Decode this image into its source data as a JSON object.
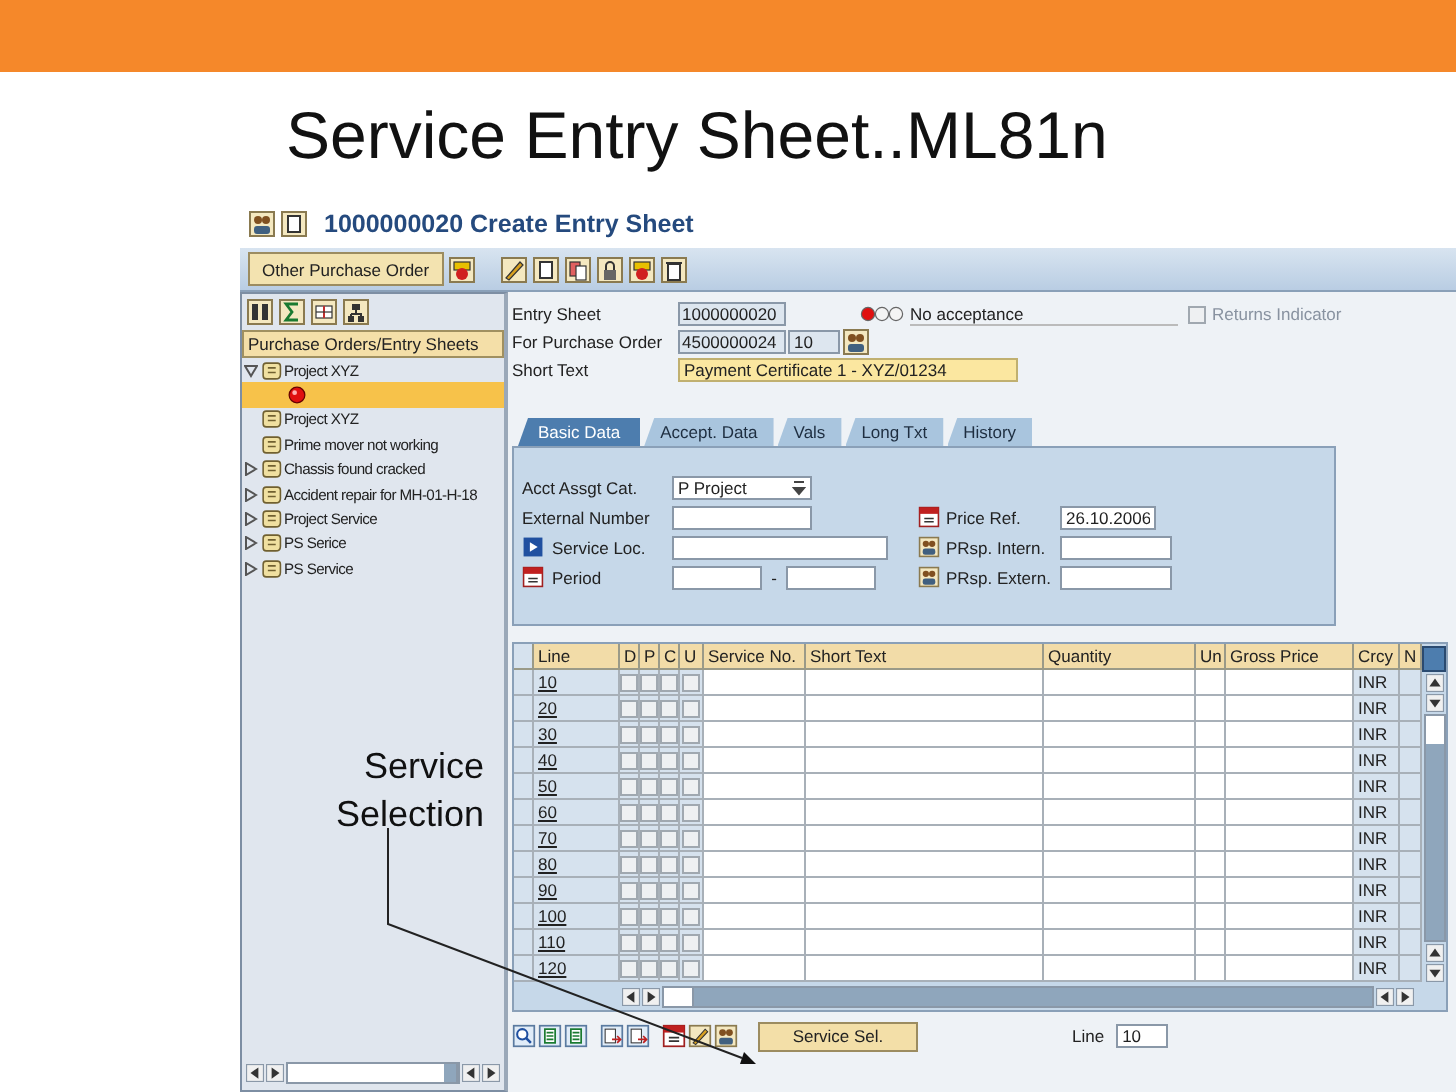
{
  "slide_title": "Service Entry Sheet..ML81n",
  "window": {
    "title": "1000000020 Create Entry Sheet"
  },
  "toolbar": {
    "button": "Other Purchase Order"
  },
  "tree": {
    "header": "Purchase Orders/Entry Sheets",
    "items": [
      {
        "kind": "node",
        "label": "Project XYZ",
        "expanded": true,
        "selected": false,
        "children": [
          {
            "kind": "entry-sheet",
            "selected": true
          }
        ]
      },
      {
        "kind": "leaf",
        "label": "Project XYZ",
        "selected": false
      },
      {
        "kind": "leaf",
        "label": "Prime mover not working",
        "selected": false
      },
      {
        "kind": "node",
        "label": "Chassis found cracked",
        "expanded": false,
        "selected": false
      },
      {
        "kind": "node",
        "label": "Accident repair for MH-01-H-18",
        "expanded": false,
        "selected": false
      },
      {
        "kind": "node",
        "label": "Project Service",
        "expanded": false,
        "selected": false
      },
      {
        "kind": "node",
        "label": "PS Serice",
        "expanded": false,
        "selected": false
      },
      {
        "kind": "node",
        "label": "PS Service",
        "expanded": false,
        "selected": false
      }
    ]
  },
  "callout": {
    "text": "Service Selection"
  },
  "header": {
    "entry_sheet_label": "Entry Sheet",
    "entry_sheet": "1000000020",
    "status": {
      "lights": [
        {
          "on": true
        },
        {
          "on": false
        },
        {
          "on": false
        }
      ],
      "text": "No acceptance"
    },
    "returns_indicator": {
      "label": "Returns Indicator",
      "checked": false
    },
    "po_label": "For Purchase Order",
    "purchase_order": "4500000024",
    "po_item": "10",
    "short_text_label": "Short Text",
    "short_text": "Payment Certificate 1 - XYZ/01234"
  },
  "tabs": [
    {
      "label": "Basic Data",
      "selected": true
    },
    {
      "label": "Accept. Data",
      "selected": false
    },
    {
      "label": "Vals",
      "selected": false
    },
    {
      "label": "Long Txt",
      "selected": false
    },
    {
      "label": "History",
      "selected": false
    }
  ],
  "basic_data": {
    "acct_assgt_label": "Acct Assgt Cat.",
    "acct_assgt": "P Project",
    "external_number_label": "External Number",
    "service_loc_label": "Service Loc.",
    "period_label": "Period",
    "period_separator": "-",
    "price_ref_label": "Price Ref.",
    "price_ref": "26.10.2006",
    "prsp_intern_label": "PRsp. Intern.",
    "prsp_extern_label": "PRsp. Extern."
  },
  "table": {
    "columns": [
      "Line",
      "D",
      "P",
      "C",
      "U",
      "Service No.",
      "Short Text",
      "Quantity",
      "Un",
      "Gross Price",
      "Crcy",
      "N"
    ],
    "rows": [
      {
        "line": "10",
        "d": false,
        "p": false,
        "c": false,
        "u": false,
        "crcy": "INR"
      },
      {
        "line": "20",
        "d": false,
        "p": false,
        "c": false,
        "u": false,
        "crcy": "INR"
      },
      {
        "line": "30",
        "d": false,
        "p": false,
        "c": false,
        "u": false,
        "crcy": "INR"
      },
      {
        "line": "40",
        "d": false,
        "p": false,
        "c": false,
        "u": false,
        "crcy": "INR"
      },
      {
        "line": "50",
        "d": false,
        "p": false,
        "c": false,
        "u": false,
        "crcy": "INR"
      },
      {
        "line": "60",
        "d": false,
        "p": false,
        "c": false,
        "u": false,
        "crcy": "INR"
      },
      {
        "line": "70",
        "d": false,
        "p": false,
        "c": false,
        "u": false,
        "crcy": "INR"
      },
      {
        "line": "80",
        "d": false,
        "p": false,
        "c": false,
        "u": false,
        "crcy": "INR"
      },
      {
        "line": "90",
        "d": false,
        "p": false,
        "c": false,
        "u": false,
        "crcy": "INR"
      },
      {
        "line": "100",
        "d": false,
        "p": false,
        "c": false,
        "u": false,
        "crcy": "INR"
      },
      {
        "line": "110",
        "d": false,
        "p": false,
        "c": false,
        "u": false,
        "crcy": "INR"
      },
      {
        "line": "120",
        "d": false,
        "p": false,
        "c": false,
        "u": false,
        "crcy": "INR"
      }
    ]
  },
  "bottom": {
    "service_button": "Service Sel.",
    "line_label": "Line",
    "line_value": "10"
  }
}
